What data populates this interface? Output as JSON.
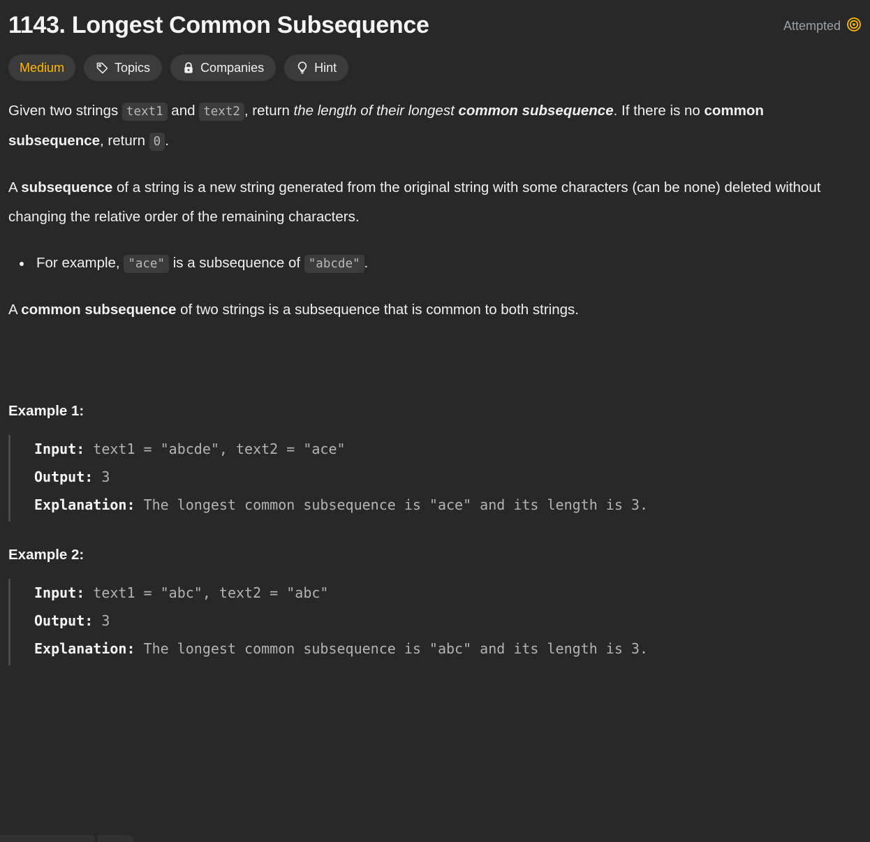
{
  "header": {
    "title": "1143. Longest Common Subsequence",
    "status_label": "Attempted",
    "status_icon": "target-icon",
    "status_color": "#ffb800"
  },
  "pills": [
    {
      "label": "Medium",
      "icon": null,
      "kind": "difficulty",
      "color": "#ffb800"
    },
    {
      "label": "Topics",
      "icon": "tag-icon",
      "kind": "action"
    },
    {
      "label": "Companies",
      "icon": "lock-icon",
      "kind": "action"
    },
    {
      "label": "Hint",
      "icon": "lightbulb-icon",
      "kind": "action"
    }
  ],
  "description": {
    "p1": {
      "s1": "Given two strings ",
      "code1": "text1",
      "s2": " and ",
      "code2": "text2",
      "s3": ", return ",
      "ital1": "the length of their longest ",
      "bi1": "common subsequence",
      "s4": ". If there is no ",
      "b1": "common subsequence",
      "s5": ", return ",
      "code3": "0",
      "s6": "."
    },
    "p2": {
      "s1": "A ",
      "b1": "subsequence",
      "s2": " of a string is a new string generated from the original string with some characters (can be none) deleted without changing the relative order of the remaining characters."
    },
    "bullet1": {
      "s1": "For example, ",
      "code1": "\"ace\"",
      "s2": " is a subsequence of ",
      "code2": "\"abcde\"",
      "s3": "."
    },
    "p3": {
      "s1": "A ",
      "b1": "common subsequence",
      "s2": " of two strings is a subsequence that is common to both strings."
    }
  },
  "examples": [
    {
      "heading": "Example 1:",
      "input_label": "Input:",
      "input_value": " text1 = \"abcde\", text2 = \"ace\"",
      "output_label": "Output:",
      "output_value": " 3",
      "explanation_label": "Explanation:",
      "explanation_value": " The longest common subsequence is \"ace\" and its length is 3."
    },
    {
      "heading": "Example 2:",
      "input_label": "Input:",
      "input_value": " text1 = \"abc\", text2 = \"abc\"",
      "output_label": "Output:",
      "output_value": " 3",
      "explanation_label": "Explanation:",
      "explanation_value": " The longest common subsequence is \"abc\" and its length is 3."
    }
  ]
}
